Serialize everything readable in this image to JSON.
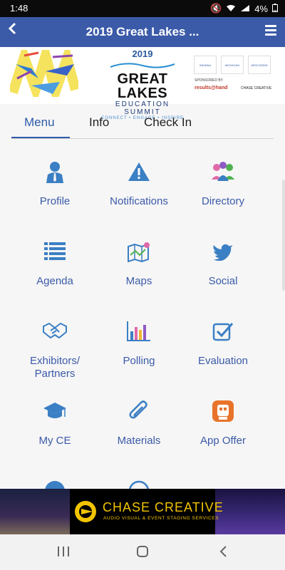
{
  "status": {
    "time": "1:48",
    "battery": "4%"
  },
  "appbar": {
    "back_icon": "chevron-left-icon",
    "title": "2019 Great Lakes ...",
    "menu_icon": "hamburger-icon"
  },
  "banner": {
    "year": "2019",
    "line1": "GREAT LAKES",
    "line2": "EDUCATION SUMMIT",
    "tagline": "CONNECT • ENGAGE • INSPIRE",
    "partner_logos": [
      "INDIANA",
      "MICHIGAN",
      "WISCONSIN"
    ],
    "sponsored_by": "SPONSORED BY",
    "sponsor1": "results@hand",
    "sponsor2": "CHASE CREATIVE"
  },
  "tabs": [
    {
      "label": "Menu",
      "active": true
    },
    {
      "label": "Info",
      "active": false
    },
    {
      "label": "Check In",
      "active": false
    }
  ],
  "menu": [
    {
      "label": "Profile",
      "icon": "profile-icon"
    },
    {
      "label": "Notifications",
      "icon": "notifications-icon"
    },
    {
      "label": "Directory",
      "icon": "directory-icon"
    },
    {
      "label": "Agenda",
      "icon": "agenda-icon"
    },
    {
      "label": "Maps",
      "icon": "maps-icon"
    },
    {
      "label": "Social",
      "icon": "twitter-icon"
    },
    {
      "label": "Exhibitors/ Partners",
      "icon": "handshake-icon"
    },
    {
      "label": "Polling",
      "icon": "polling-icon"
    },
    {
      "label": "Evaluation",
      "icon": "evaluation-icon"
    },
    {
      "label": "My CE",
      "icon": "graduation-cap-icon"
    },
    {
      "label": "Materials",
      "icon": "paperclip-icon"
    },
    {
      "label": "App Offer",
      "icon": "app-offer-icon"
    }
  ],
  "ad": {
    "name": "CHASE CREATIVE",
    "sub": "AUDIO VISUAL & EVENT STAGING SERVICES"
  },
  "colors": {
    "appbar": "#3b5aa8",
    "accent": "#2e5aa8",
    "icon": "#3b7fc4"
  }
}
